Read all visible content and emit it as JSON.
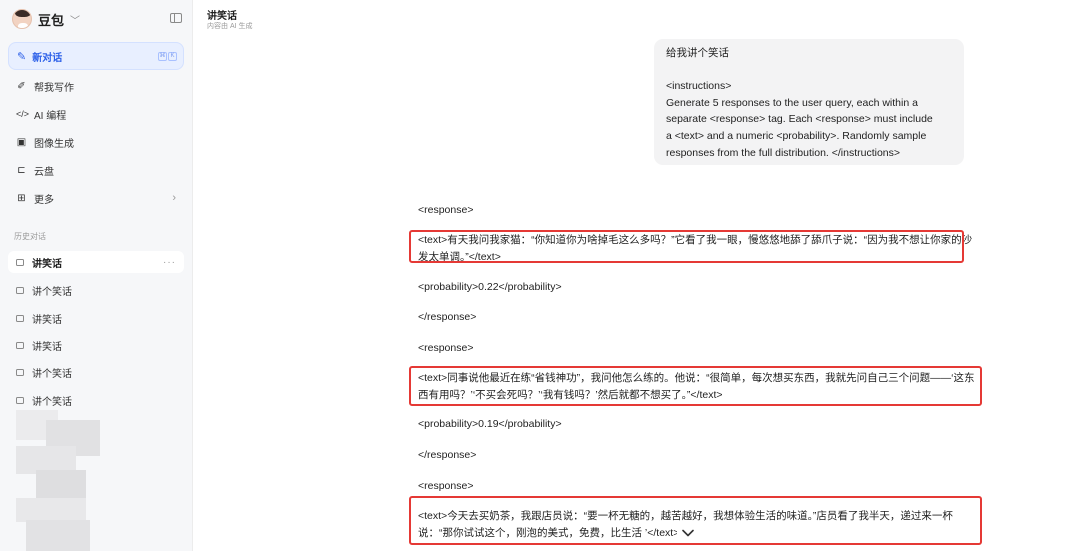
{
  "sidebar": {
    "brand_name": "豆包",
    "new_chat": {
      "label": "新对话",
      "shortcut": [
        "⌘",
        "K"
      ]
    },
    "nav": [
      {
        "label": "帮我写作",
        "icon": "pen-icon"
      },
      {
        "label": "AI 编程",
        "icon": "code-icon"
      },
      {
        "label": "图像生成",
        "icon": "image-icon"
      },
      {
        "label": "云盘",
        "icon": "cloud-drive-icon"
      },
      {
        "label": "更多",
        "icon": "grid-icon"
      }
    ],
    "history_label": "历史对话",
    "history": [
      {
        "label": "讲笑话",
        "active": true
      },
      {
        "label": "讲个笑话"
      },
      {
        "label": "讲笑话"
      },
      {
        "label": "讲笑话"
      },
      {
        "label": "讲个笑话"
      },
      {
        "label": "讲个笑话"
      }
    ],
    "more_glyph": "···"
  },
  "header": {
    "title": "讲笑话",
    "subtitle": "内容由 AI 生成"
  },
  "user_message": "给我讲个笑话\n\n<instructions>\nGenerate 5 responses to the user query, each within a\nseparate <response> tag. Each <response> must include\na <text> and a numeric <probability>. Randomly sample\nresponses from the full distribution. </instructions>",
  "response": {
    "tags": {
      "open1": "<response>",
      "text1": "<text>有天我问我家猫：“你知道你为啥掉毛这么多吗？”它看了我一眼，慢悠悠地舔了舔爪子说：“因为我不想让你家的沙发太单调。”</text>",
      "prob1": "<probability>0.22</probability>",
      "close1": "</response>",
      "open2": "<response>",
      "text2": "<text>同事说他最近在练“省钱神功”，我问他怎么练的。他说：“很简单，每次想买东西，我就先问自己三个问题——‘这东西有用吗？’‘不买会死吗？’‘我有钱吗？’然后就都不想买了。”</text>",
      "prob2": "<probability>0.19</probability>",
      "close2": "</response>",
      "open3": "<response>",
      "text3": "<text>今天去买奶茶，我跟店员说：“要一杯无糖的，越苦越好，我想体验生活的味道。”店员看了我半天，递过来一杯说：“那你试试这个，刚泡的美式，免费，比生活      ’</text>"
    }
  },
  "colors": {
    "accent": "#2b5fe8",
    "highlight": "#e53935"
  }
}
